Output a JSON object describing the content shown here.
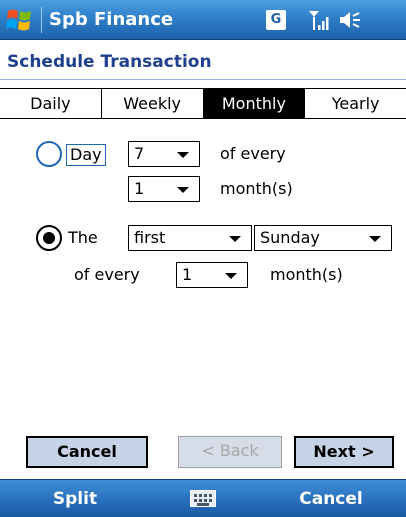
{
  "titlebar": {
    "app_title": "Spb Finance",
    "tray_badge": "G",
    "icons": [
      "windows-flag-icon",
      "signal-icon",
      "volume-icon"
    ]
  },
  "header": {
    "title": "Schedule Transaction"
  },
  "tabs": [
    {
      "label": "Daily",
      "active": false
    },
    {
      "label": "Weekly",
      "active": false
    },
    {
      "label": "Monthly",
      "active": true
    },
    {
      "label": "Yearly",
      "active": false
    }
  ],
  "option_day": {
    "radio_selected": false,
    "label": "Day",
    "day_value": "7",
    "of_every_text": "of every",
    "interval_value": "1",
    "months_text": "month(s)"
  },
  "option_the": {
    "radio_selected": true,
    "label": "The",
    "ordinal_value": "first",
    "weekday_value": "Sunday",
    "of_every_text": "of every",
    "interval_value": "1",
    "months_text": "month(s)"
  },
  "buttons": {
    "cancel": "Cancel",
    "back": "< Back",
    "next": "Next >"
  },
  "softkeys": {
    "left": "Split",
    "right": "Cancel"
  },
  "colors": {
    "titlebar": "#2f7fc9",
    "header_text": "#1f3f8f",
    "button_bg": "#c6d3e6"
  }
}
